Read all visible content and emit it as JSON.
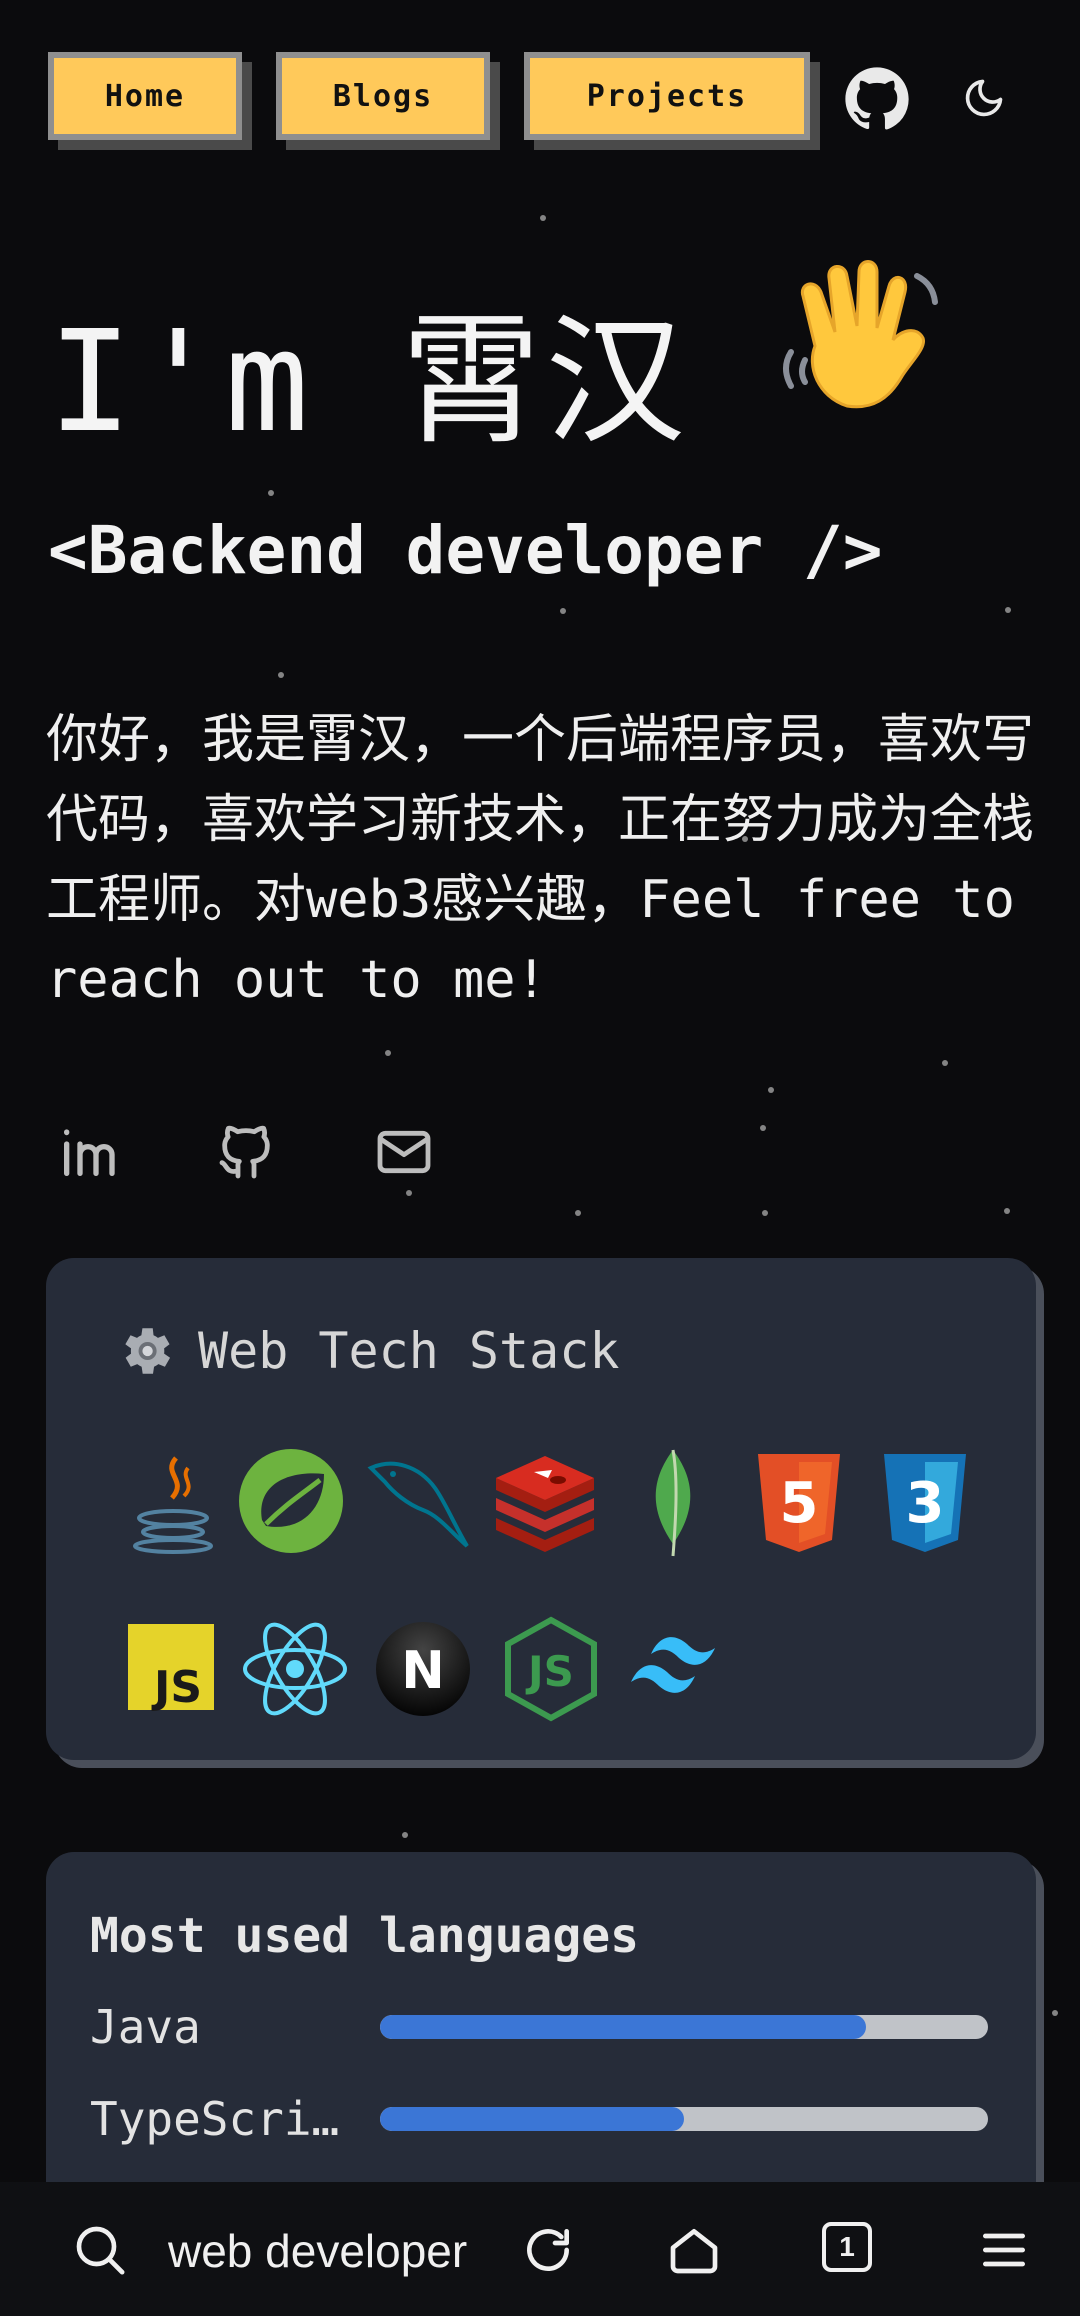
{
  "nav": {
    "items": [
      "Home",
      "Blogs",
      "Projects"
    ],
    "github_icon": "github-icon",
    "theme_icon": "moon-icon"
  },
  "hero": {
    "title": "I'm 霄汉",
    "emoji": "👋",
    "subtitle": "<Backend developer />"
  },
  "bio": "你好，我是霄汉，一个后端程序员，喜欢写代码，喜欢学习新技术，正在努力成为全栈工程师。对web3感兴趣，Feel free to reach out to me!",
  "social": [
    "linkedin-icon",
    "github-icon",
    "mail-icon"
  ],
  "tech_stack": {
    "title": "Web Tech Stack",
    "icon": "gear-icon",
    "items": [
      "java",
      "spring",
      "mysql",
      "redis",
      "mongodb",
      "html5",
      "css3",
      "javascript",
      "react",
      "nextjs",
      "nodejs",
      "tailwindcss"
    ],
    "badges": {
      "javascript": "JS",
      "nextjs": "N",
      "html5": "5",
      "css3": "3",
      "nodejs": "JS"
    }
  },
  "languages": {
    "title": "Most used languages",
    "items": [
      {
        "name": "Java",
        "percent": 80
      },
      {
        "name": "TypeScri…",
        "percent": 50
      }
    ]
  },
  "browser": {
    "url_text": "web developer",
    "tab_count": "1"
  },
  "colors": {
    "accent": "#ffc95a",
    "bar_fill": "#3b76d6",
    "card": "#262c39",
    "background": "#0b0b0d"
  }
}
